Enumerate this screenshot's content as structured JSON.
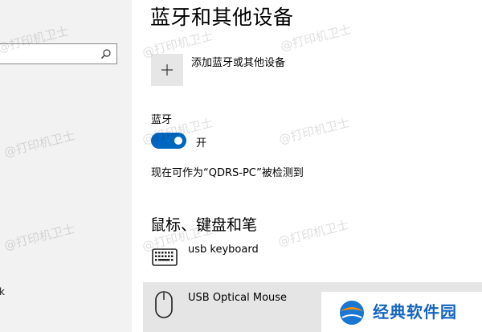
{
  "sidebar": {
    "search_placeholder": "",
    "cut_text": "k"
  },
  "page": {
    "title": "蓝牙和其他设备",
    "add_device_label": "添加蓝牙或其他设备",
    "add_icon": "plus-icon"
  },
  "bluetooth": {
    "label": "蓝牙",
    "toggle_on": true,
    "state_text": "开",
    "discoverable_text": "现在可作为“QDRS-PC”被检测到",
    "accent_color": "#0067c0"
  },
  "devices_section": {
    "title": "鼠标、键盘和笔",
    "devices": [
      {
        "name": "usb keyboard",
        "icon": "keyboard-icon"
      },
      {
        "name": "USB Optical Mouse",
        "icon": "mouse-icon"
      }
    ]
  },
  "watermark": {
    "text": "@打印机卫士"
  },
  "brand": {
    "text": "经典软件园"
  }
}
